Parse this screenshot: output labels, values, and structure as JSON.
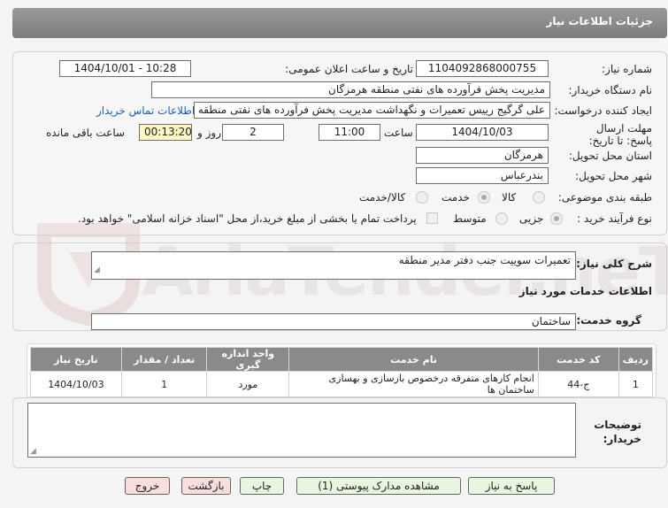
{
  "header": {
    "title": "جزئيات اطلاعات نياز"
  },
  "watermark": {
    "text": "AriaTender.neT"
  },
  "form": {
    "need_number_label": "شماره نیاز:",
    "need_number": "1104092868000755",
    "announce_label": "تاریخ و ساعت اعلان عمومی:",
    "announce_value": "1404/10/01 - 10:28",
    "buyer_label": "نام دستگاه خریدار:",
    "buyer_value": "مدیریت پخش فرآورده های نفتی منطقه هرمزگان",
    "creator_label": "ایجاد کننده درخواست:",
    "creator_value": "علی گرگیج رییس تعمیرات و نگهداشت مدیریت پخش فرآورده های نفتی منطقه هرمزگان",
    "contact_link": "اطلاعات تماس خریدار",
    "deadline_label": "مهلت ارسال پاسخ: تا تاریخ:",
    "deadline_date": "1404/10/03",
    "time_label": "ساعت",
    "deadline_time": "11:00",
    "days_value": "2",
    "days_label": "روز و",
    "remaining_time": "00:13:20",
    "remaining_label": "ساعت باقی مانده",
    "province_label": "استان محل تحویل:",
    "province_value": "هرمزگان",
    "city_label": "شهر محل تحویل:",
    "city_value": "بندرعباس",
    "category_label": "طبقه بندی موضوعی:",
    "category_options": [
      "کالا",
      "خدمت",
      "کالا/خدمت"
    ],
    "process_label": "نوع فرآیند خرید :",
    "process_options": [
      "جزیی",
      "متوسط"
    ],
    "payment_note": "پرداخت تمام یا بخشی از مبلغ خرید،از محل \"اسناد خزانه اسلامی\" خواهد بود."
  },
  "description": {
    "label": "شرح کلی نیاز:",
    "value": "تعمیرات سوییت جنب دفتر مدیر منطقه"
  },
  "services": {
    "section_title": "اطلاعات خدمات مورد نیاز",
    "group_label": "گروه خدمت:",
    "group_value": "ساختمان",
    "columns": [
      "ردیف",
      "کد خدمت",
      "نام خدمت",
      "واحد اندازه گیری",
      "تعداد / مقدار",
      "تاریخ نیاز"
    ],
    "rows": [
      {
        "row": "1",
        "code": "ج-44",
        "name": "انجام کارهای متفرقه درخصوص بازسازی و بهسازی ساختمان ها",
        "unit": "مورد",
        "qty": "1",
        "date": "1404/10/03"
      }
    ]
  },
  "notes": {
    "label": "توضیحات خریدار:",
    "value": ""
  },
  "buttons": {
    "reply": "پاسخ به نیاز",
    "attachments": "مشاهده مدارک پیوستی (1)",
    "print": "چاپ",
    "back": "بازگشت",
    "exit": "خروج"
  }
}
